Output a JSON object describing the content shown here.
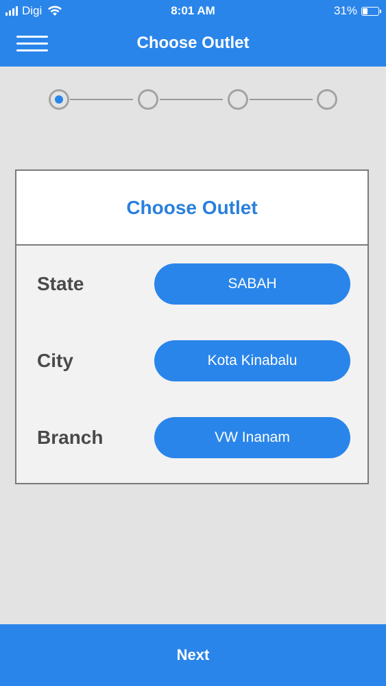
{
  "status_bar": {
    "carrier": "Digi",
    "time": "8:01 AM",
    "battery": "31%",
    "battery_level": 0.31,
    "icons": [
      "signal-icon",
      "wifi-icon",
      "battery-icon"
    ]
  },
  "header": {
    "title": "Choose Outlet",
    "menu_icon": "hamburger-icon"
  },
  "stepper": {
    "total_steps": 4,
    "active_step": 1
  },
  "card": {
    "title": "Choose Outlet",
    "rows": [
      {
        "label": "State",
        "value": "SABAH"
      },
      {
        "label": "City",
        "value": "Kota Kinabalu"
      },
      {
        "label": "Branch",
        "value": "VW Inanam"
      }
    ]
  },
  "footer": {
    "next_label": "Next"
  },
  "colors": {
    "primary": "#2a85ea",
    "title_text": "#2a7fdc",
    "background": "#e3e3e3",
    "card_body": "#f2f2f3",
    "label_text": "#4a4a4a"
  }
}
